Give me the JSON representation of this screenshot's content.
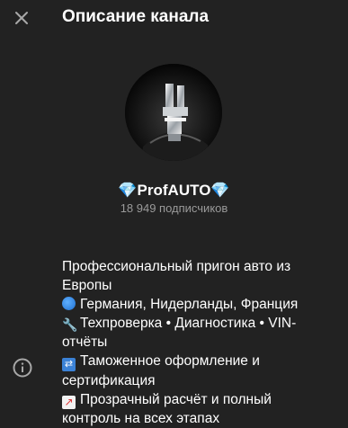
{
  "header": {
    "title": "Описание канала",
    "close_icon": "close-icon"
  },
  "channel": {
    "name": "💎ProfAUTO💎",
    "subscribers": "18 949 подписчиков"
  },
  "description": {
    "icon": "info-icon",
    "lines": [
      {
        "text": "Профессиональный пригон авто из",
        "emoji": ""
      },
      {
        "text": "Европы",
        "emoji": ""
      },
      {
        "text": "Германия, Нидерланды, Франция",
        "emoji": "globe"
      },
      {
        "text": "Техпроверка • Диагностика • VIN-",
        "emoji": "wrench"
      },
      {
        "text": "отчёты",
        "emoji": ""
      },
      {
        "text": "Таможенное оформление и",
        "emoji": "customs"
      },
      {
        "text": "сертификация",
        "emoji": ""
      },
      {
        "text": "Прозрачный расчёт и полный",
        "emoji": "chart"
      },
      {
        "text": "контроль на всех этапах",
        "emoji": ""
      }
    ]
  },
  "colors": {
    "background": "#222222",
    "secondary_text": "#9a9a9a"
  }
}
